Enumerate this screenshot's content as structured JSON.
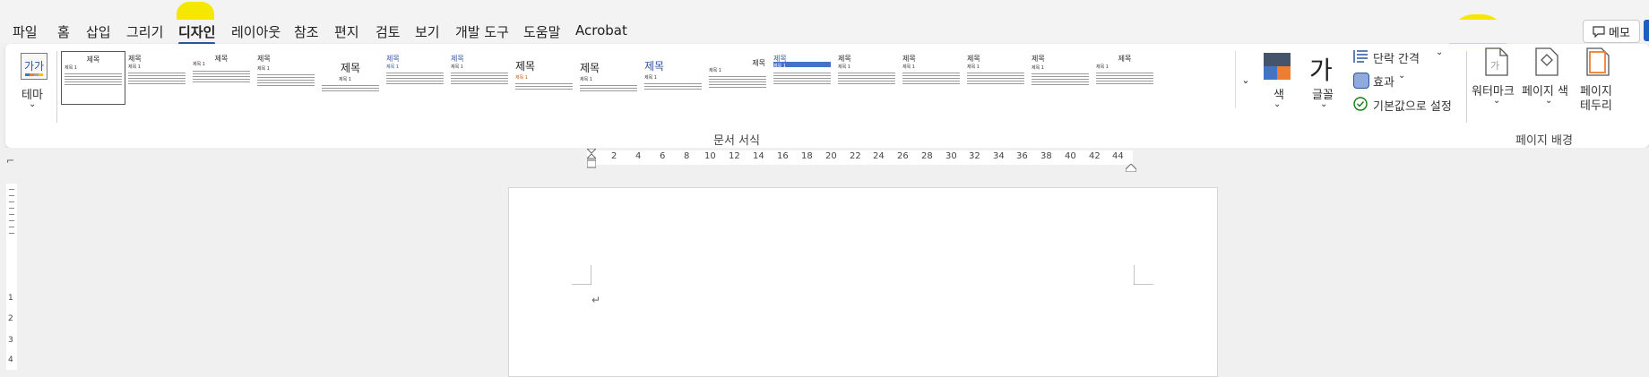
{
  "menu": {
    "items": [
      "파일",
      "홈",
      "삽입",
      "그리기",
      "디자인",
      "레이아웃",
      "참조",
      "편지",
      "검토",
      "보기",
      "개발 도구",
      "도움말",
      "Acrobat"
    ],
    "active": "디자인"
  },
  "memo_label": "메모",
  "ribbon": {
    "theme_icon_text": "가가",
    "theme_label": "테마",
    "gallery": [
      {
        "title": "제목",
        "sub": "제목 1"
      },
      {
        "title": "제목",
        "sub": "제목 1"
      },
      {
        "title": "제목",
        "sub": "제목 1"
      },
      {
        "title": "제목",
        "sub": "제목 1"
      },
      {
        "title": "제목",
        "sub": "제목 1"
      },
      {
        "title": "제목",
        "sub": "제목 1"
      },
      {
        "title": "제목",
        "sub": "제목 1"
      },
      {
        "title": "제목",
        "sub": "제목 1"
      },
      {
        "title": "제목",
        "sub": "제목 1"
      },
      {
        "title": "제목",
        "sub": "제목 1"
      },
      {
        "title": "제목",
        "sub": "제목 1"
      },
      {
        "title": "제목",
        "sub": "제목 1"
      },
      {
        "title": "제목",
        "sub": "제목 1"
      },
      {
        "title": "제목",
        "sub": "제목 1"
      },
      {
        "title": "제목",
        "sub": "제목 1"
      },
      {
        "title": "제목",
        "sub": "제목 1"
      },
      {
        "title": "제목",
        "sub": "제목 1"
      }
    ],
    "document_format_group": "문서 서식",
    "colors_label": "색",
    "fonts_icon_text": "가",
    "fonts_label": "글꼴",
    "paragraph_spacing": "단락 간격",
    "effects": "효과",
    "set_default": "기본값으로 설정",
    "watermark_label": "워터마크",
    "page_color_label": "페이지 색",
    "page_borders_label_1": "페이지",
    "page_borders_label_2": "테두리",
    "page_background_group": "페이지 배경"
  },
  "ruler": {
    "ticks": [
      "2",
      "4",
      "6",
      "8",
      "10",
      "12",
      "14",
      "16",
      "18",
      "20",
      "22",
      "24",
      "26",
      "28",
      "30",
      "32",
      "34",
      "36",
      "38",
      "40",
      "42",
      "44"
    ]
  },
  "vruler_labels": [
    "1",
    "2",
    "3",
    "4"
  ],
  "colors": {
    "accent": "#2b579a",
    "highlight": "#f5e800",
    "swatch_dark": "#44546a",
    "swatch_blue": "#4472c4",
    "swatch_orange": "#ed7d31",
    "swatch_gray": "#a5a5a5"
  },
  "pilcrow": "↵"
}
